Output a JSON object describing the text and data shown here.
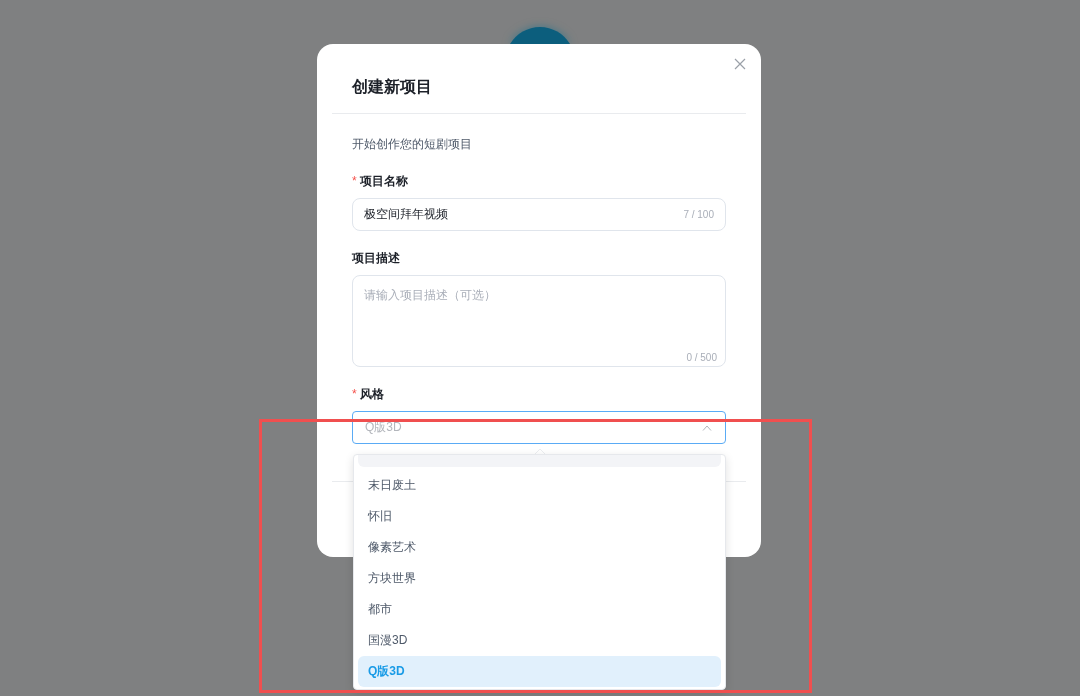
{
  "dialog": {
    "title": "创建新项目",
    "subtitle": "开始创作您的短剧项目",
    "fields": [
      {
        "kind": "input",
        "required_mark": "*",
        "label": "项目名称",
        "value": "极空间拜年视频",
        "counter": "7 / 100"
      },
      {
        "kind": "textarea",
        "label": "项目描述",
        "placeholder": "请输入项目描述（可选）",
        "counter": "0 / 500"
      },
      {
        "kind": "select",
        "required_mark": "*",
        "label": "风格",
        "value": "Q版3D",
        "open": true
      }
    ]
  },
  "dropdown": {
    "scrolled_row": {
      "hovered": true
    },
    "options": [
      {
        "label": "末日废土",
        "selected": false
      },
      {
        "label": "怀旧",
        "selected": false
      },
      {
        "label": "像素艺术",
        "selected": false
      },
      {
        "label": "方块世界",
        "selected": false
      },
      {
        "label": "都市",
        "selected": false
      },
      {
        "label": "国漫3D",
        "selected": false
      },
      {
        "label": "Q版3D",
        "selected": true
      }
    ]
  }
}
